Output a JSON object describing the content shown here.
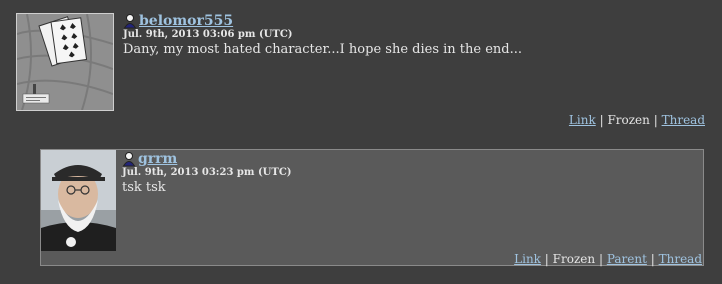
{
  "comments": [
    {
      "username": "belomor555",
      "timestamp": "Jul. 9th, 2013 03:06 pm (UTC)",
      "body": "Dany, my most hated character...I hope she dies in the end...",
      "avatar_icon": "playing-cards-avatar",
      "actions": {
        "link": "Link",
        "frozen": "Frozen",
        "thread": "Thread"
      }
    },
    {
      "username": "grrm",
      "timestamp": "Jul. 9th, 2013 03:23 pm (UTC)",
      "body": "tsk tsk",
      "avatar_icon": "bearded-man-avatar",
      "actions": {
        "link": "Link",
        "frozen": "Frozen",
        "parent": "Parent",
        "thread": "Thread"
      }
    }
  ],
  "separator": "|",
  "colors": {
    "background": "#3e3e3e",
    "reply_background": "#5a5a5a",
    "link": "#9fc3e0",
    "text": "#e6e6e6"
  }
}
